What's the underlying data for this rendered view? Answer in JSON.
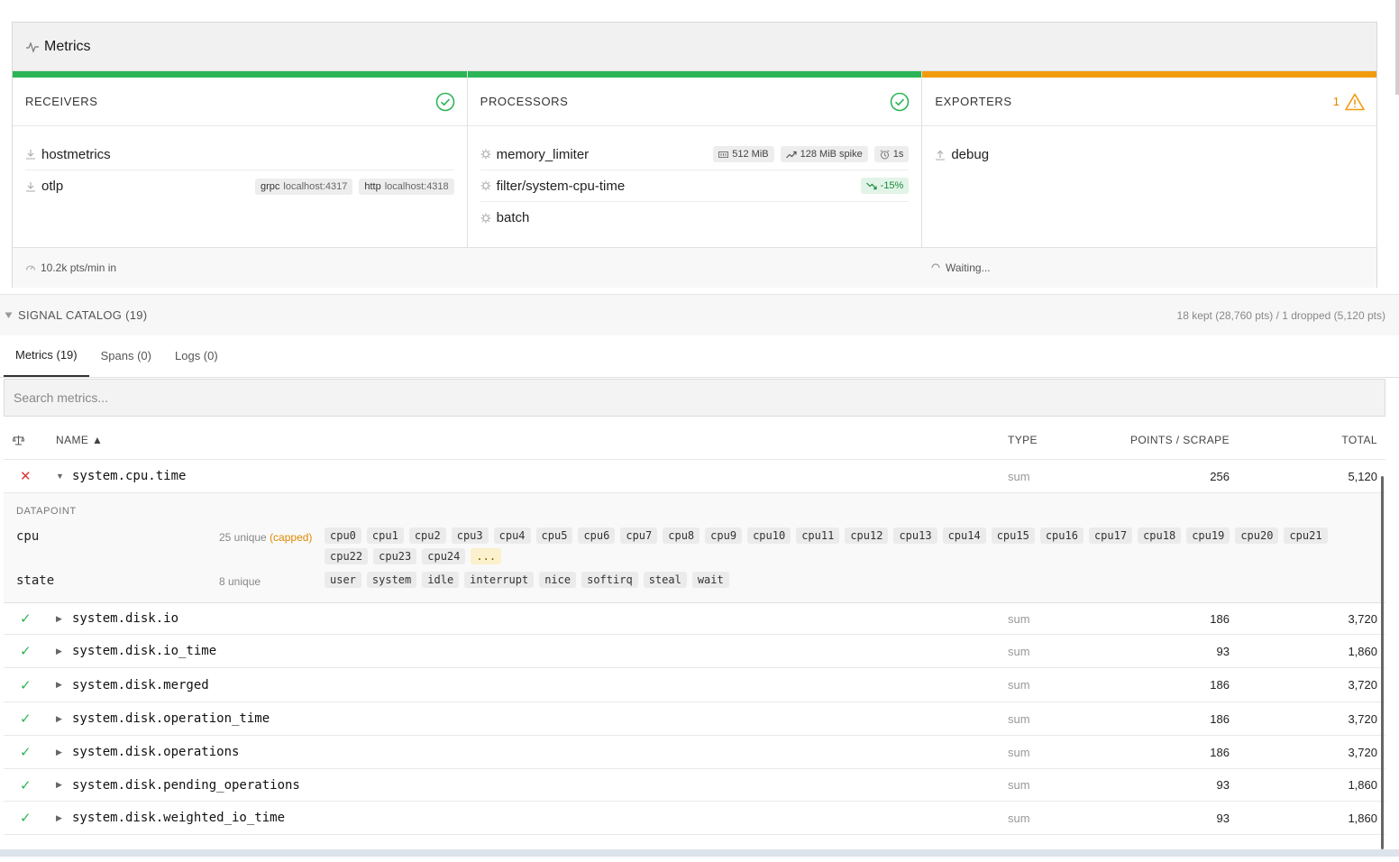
{
  "pipeline": {
    "title": "Metrics",
    "receivers": {
      "label": "RECEIVERS",
      "items": [
        {
          "name": "hostmetrics",
          "chips": []
        },
        {
          "name": "otlp",
          "chips": [
            {
              "k": "grpc",
              "v": "localhost:4317"
            },
            {
              "k": "http",
              "v": "localhost:4318"
            }
          ]
        }
      ]
    },
    "processors": {
      "label": "PROCESSORS",
      "items": [
        {
          "name": "memory_limiter",
          "chips": [
            {
              "icon": "memory-icon",
              "text": "512 MiB"
            },
            {
              "icon": "trend-up-icon",
              "text": "128 MiB spike"
            },
            {
              "icon": "alarm-icon",
              "text": "1s"
            }
          ]
        },
        {
          "name": "filter/system-cpu-time",
          "chips": [
            {
              "icon": "trend-down-icon",
              "text": "-15%",
              "green": true
            }
          ]
        },
        {
          "name": "batch",
          "chips": []
        }
      ]
    },
    "exporters": {
      "label": "EXPORTERS",
      "warning_count": "1",
      "items": [
        {
          "name": "debug"
        }
      ]
    },
    "footer": {
      "rate_in": "10.2k pts/min in",
      "exporter_status": "Waiting..."
    },
    "colors": {
      "ok": "#2cb457",
      "warn": "#f29a10"
    }
  },
  "catalog": {
    "title": "SIGNAL CATALOG (19)",
    "summary": "18 kept (28,760 pts) / 1 dropped (5,120 pts)",
    "tabs": [
      {
        "label": "Metrics (19)",
        "active": true
      },
      {
        "label": "Spans (0)"
      },
      {
        "label": "Logs (0)"
      }
    ],
    "search_placeholder": "Search metrics...",
    "columns": {
      "name": "NAME ▲",
      "type": "TYPE",
      "points": "POINTS / SCRAPE",
      "total": "TOTAL"
    },
    "rows": [
      {
        "status": "dropped",
        "expanded": true,
        "name": "system.cpu.time",
        "type": "sum",
        "points": "256",
        "total": "5,120"
      },
      {
        "status": "kept",
        "name": "system.disk.io",
        "type": "sum",
        "points": "186",
        "total": "3,720"
      },
      {
        "status": "kept",
        "name": "system.disk.io_time",
        "type": "sum",
        "points": "93",
        "total": "1,860"
      },
      {
        "status": "kept",
        "name": "system.disk.merged",
        "type": "sum",
        "points": "186",
        "total": "3,720"
      },
      {
        "status": "kept",
        "name": "system.disk.operation_time",
        "type": "sum",
        "points": "186",
        "total": "3,720"
      },
      {
        "status": "kept",
        "name": "system.disk.operations",
        "type": "sum",
        "points": "186",
        "total": "3,720"
      },
      {
        "status": "kept",
        "name": "system.disk.pending_operations",
        "type": "sum",
        "points": "93",
        "total": "1,860"
      },
      {
        "status": "kept",
        "name": "system.disk.weighted_io_time",
        "type": "sum",
        "points": "93",
        "total": "1,860"
      }
    ],
    "detail": {
      "section": "DATAPOINT",
      "attributes": [
        {
          "name": "cpu",
          "unique": "25 unique",
          "capped": "(capped)",
          "values": [
            "cpu0",
            "cpu1",
            "cpu2",
            "cpu3",
            "cpu4",
            "cpu5",
            "cpu6",
            "cpu7",
            "cpu8",
            "cpu9",
            "cpu10",
            "cpu11",
            "cpu12",
            "cpu13",
            "cpu14",
            "cpu15",
            "cpu16",
            "cpu17",
            "cpu18",
            "cpu19",
            "cpu20",
            "cpu21",
            "cpu22",
            "cpu23",
            "cpu24"
          ],
          "more": "..."
        },
        {
          "name": "state",
          "unique": "8 unique",
          "values": [
            "user",
            "system",
            "idle",
            "interrupt",
            "nice",
            "softirq",
            "steal",
            "wait"
          ]
        }
      ]
    }
  }
}
